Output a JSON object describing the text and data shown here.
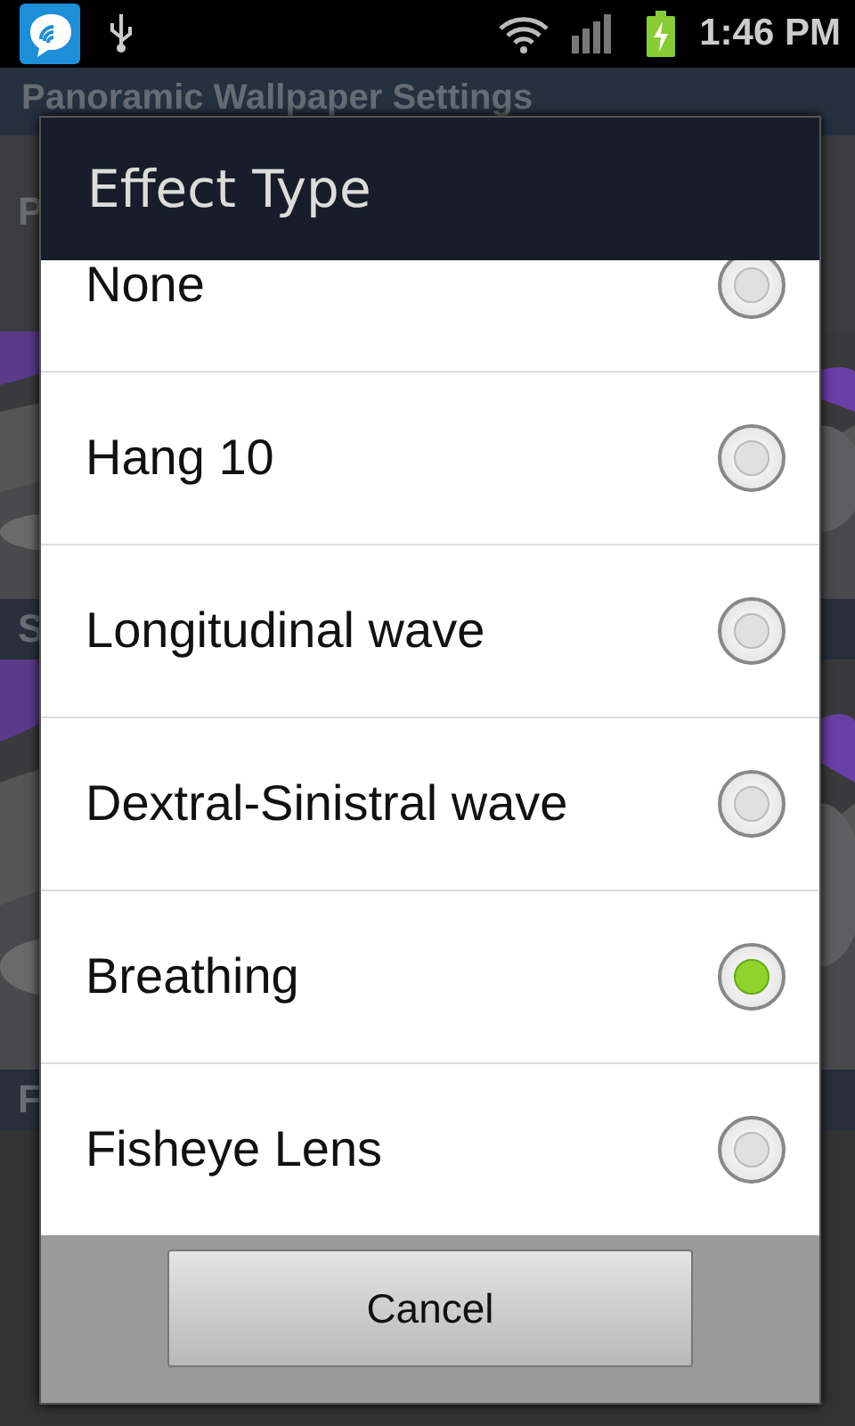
{
  "status_bar": {
    "time": "1:46 PM"
  },
  "app_bar": {
    "title": "Panoramic Wallpaper Settings"
  },
  "background_sections": [
    {
      "label": "P",
      "kind": "header"
    },
    {
      "kind": "picture"
    },
    {
      "label": "S",
      "kind": "dark-header"
    },
    {
      "kind": "picture"
    },
    {
      "label": "F",
      "kind": "dark-header"
    }
  ],
  "dialog": {
    "title": "Effect Type",
    "options": [
      {
        "label": "None",
        "selected": false
      },
      {
        "label": "Hang 10",
        "selected": false
      },
      {
        "label": "Longitudinal wave",
        "selected": false
      },
      {
        "label": "Dextral-Sinistral wave",
        "selected": false
      },
      {
        "label": "Breathing",
        "selected": true
      },
      {
        "label": "Fisheye Lens",
        "selected": false
      }
    ],
    "buttons": [
      "Cancel"
    ]
  }
}
